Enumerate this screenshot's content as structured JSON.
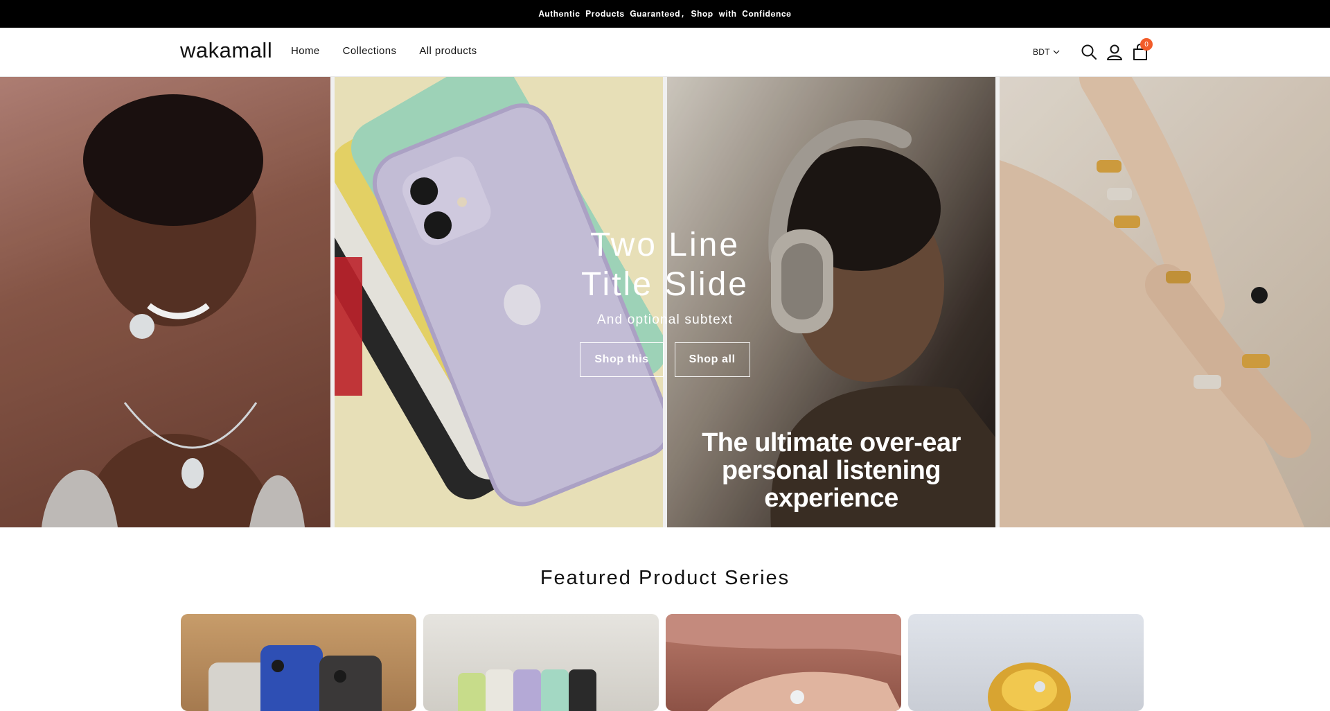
{
  "announcement": {
    "text": "𝐀𝐮𝐭𝐡𝐞𝐧𝐭𝐢𝐜 𝐏𝐫𝐨𝐝𝐮𝐜𝐭𝐬 𝐆𝐮𝐚𝐫𝐚𝐧𝐭𝐞𝐞𝐝, 𝐒𝐡𝐨𝐩 𝐰𝐢𝐭𝐡 𝐂𝐨𝐧𝐟𝐢𝐝𝐞𝐧𝐜𝐞"
  },
  "header": {
    "logo": "wakamall",
    "nav": [
      "Home",
      "Collections",
      "All products"
    ],
    "currency": "BDT",
    "cart_count": "0",
    "icons": [
      "search-icon",
      "account-icon",
      "cart-icon",
      "chevron-down-icon"
    ]
  },
  "hero": {
    "title_line1": "Two Line",
    "title_line2": "Title Slide",
    "subtext": "And optional subtext",
    "button_primary": "Shop this",
    "button_secondary": "Shop all",
    "panel_caption_line1": "The ultimate over-ear",
    "panel_caption_line2": "personal listening experience"
  },
  "featured": {
    "title": "Featured Product Series"
  },
  "colors": {
    "announcement_bg": "#000000",
    "cart_badge": "#f25c2a",
    "text": "#121212"
  }
}
